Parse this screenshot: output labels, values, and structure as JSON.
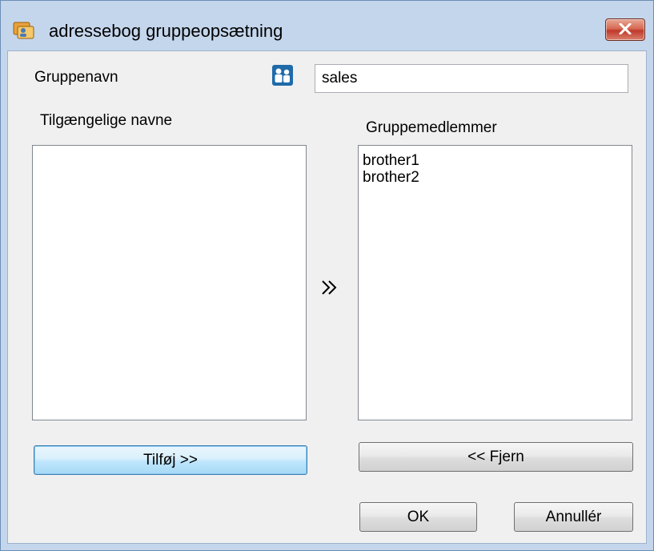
{
  "window": {
    "title": "adressebog gruppeopsætning"
  },
  "group_name": {
    "label": "Gruppenavn",
    "value": "sales"
  },
  "available": {
    "label": "Tilgængelige navne",
    "items": []
  },
  "members": {
    "label": "Gruppemedlemmer",
    "items": [
      "brother1",
      "brother2"
    ]
  },
  "buttons": {
    "add": "Tilføj >>",
    "remove": "<< Fjern",
    "ok": "OK",
    "cancel": "Annullér"
  },
  "icons": {
    "title": "address-book-icon",
    "group": "group-users-icon",
    "move": "double-chevron-right-icon",
    "close": "close-icon"
  },
  "colors": {
    "titlebar": "#c4d6ec",
    "close_button": "#c0392b",
    "default_button": "#bee6fd"
  }
}
